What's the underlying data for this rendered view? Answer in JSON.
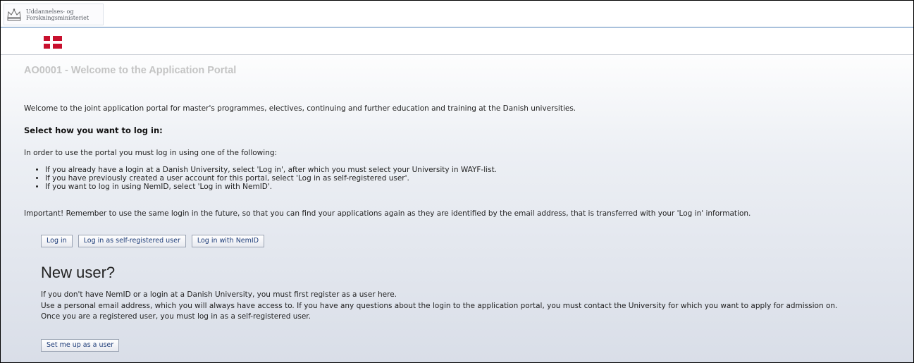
{
  "header": {
    "ministry_line1": "Uddannelses- og",
    "ministry_line2": "Forskningsministeriet",
    "crown_icon": "crown-icon",
    "flag_icon": "danish-flag-icon"
  },
  "main": {
    "title": "AO0001 - Welcome to the Application Portal",
    "intro": "Welcome to the joint application portal for master's programmes, electives, continuing and further education and training at the Danish universities.",
    "select_heading": "Select how you want to log in:",
    "order_text": "In order to use the portal you must log in using one of the following:",
    "bullets": [
      "If you already have a login at a Danish University, select 'Log in', after which you must select your University in WAYF-list.",
      "If you have previously created a user account for this portal, select 'Log in as self-registered user'.",
      "If you want to log in using NemID, select 'Log in with NemID'."
    ],
    "important": "Important! Remember to use the same login in the future, so that you can find your applications again as they are identified by the email address, that is transferred with your 'Log in' information.",
    "buttons": {
      "login": "Log in",
      "self_registered": "Log in as self-registered user",
      "nemid": "Log in with NemID"
    }
  },
  "new_user": {
    "heading": "New user?",
    "line1": "If you don't have NemID or a login at a Danish University, you must first register as a user here.",
    "line2": "Use a personal email address, which you will always have access to. If you have any questions about the login to the application portal, you must contact the University for which you want to apply for admission on.",
    "line3": "Once you are a registered user, you must log in as a self-registered user.",
    "button": "Set me up as a user"
  }
}
